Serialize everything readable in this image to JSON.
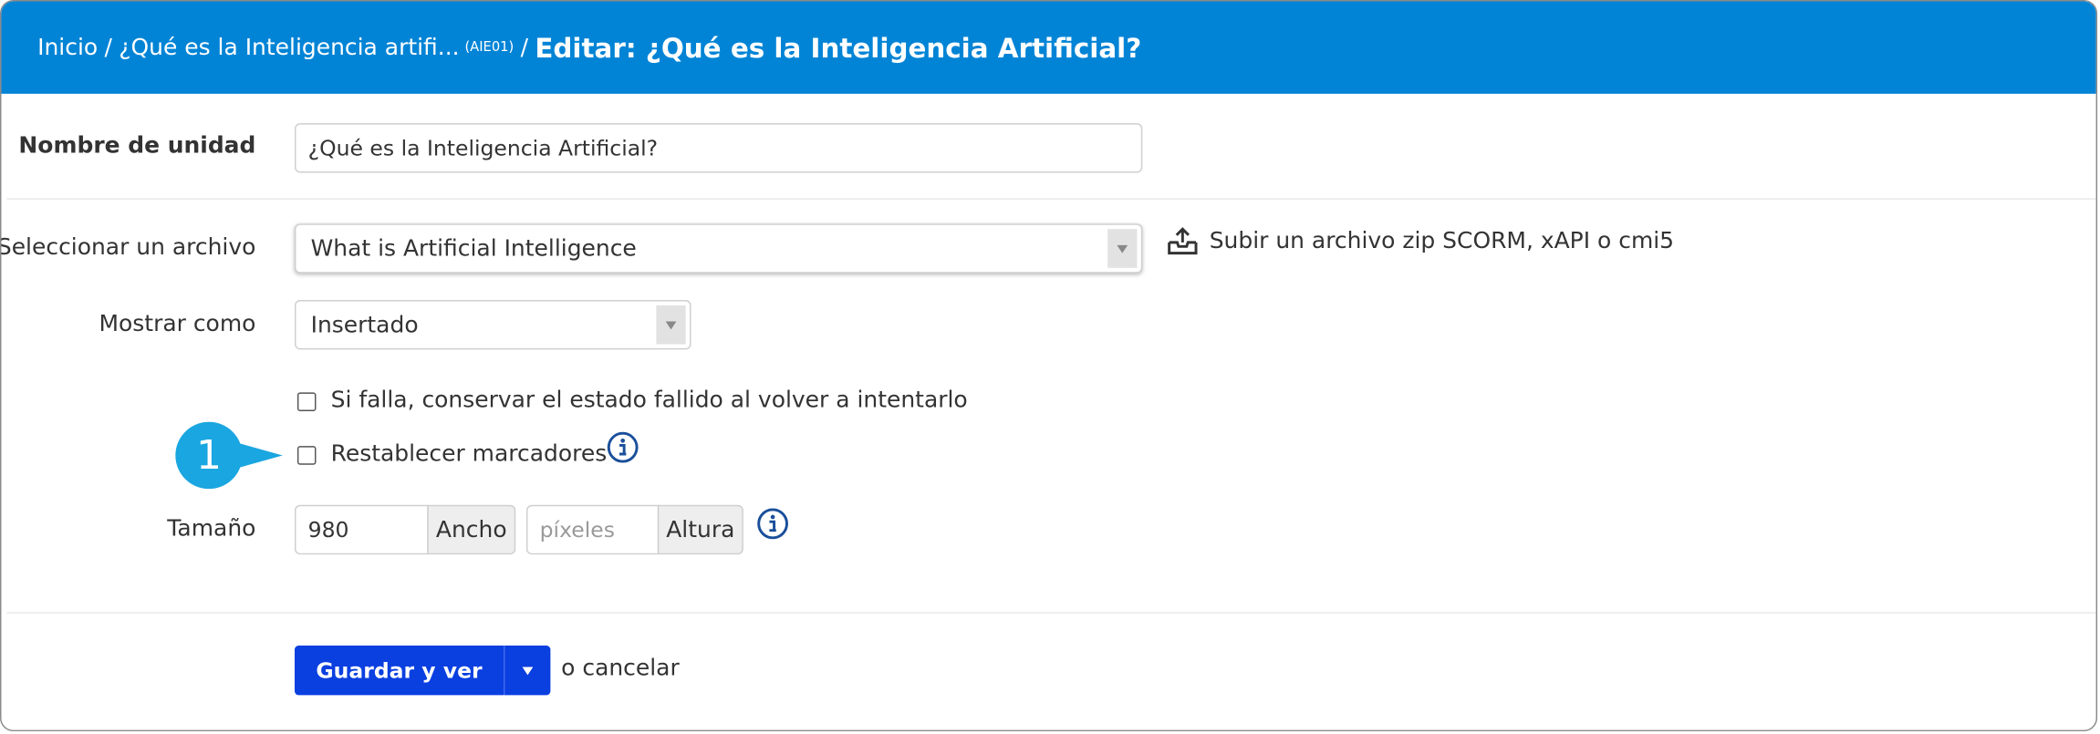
{
  "breadcrumb": {
    "home": "Inicio",
    "separator": "/",
    "course": "¿Qué es la Inteligencia artifi...",
    "course_code": "(AIE01)",
    "current": "Editar: ¿Qué es la Inteligencia Artificial?"
  },
  "unit_name": {
    "label": "Nombre de unidad",
    "value": "¿Qué es la Inteligencia Artificial?"
  },
  "file": {
    "label": "Seleccionar un archivo",
    "selected": "What is Artificial Intelligence",
    "upload_label": "Subir un archivo zip SCORM, xAPI o cmi5"
  },
  "display": {
    "label": "Mostrar como",
    "selected": "Insertado"
  },
  "options": {
    "keep_failed": "Si falla, conservar el estado fallido al volver a intentarlo",
    "reset_bookmarks": "Restablecer marcadores"
  },
  "size": {
    "label": "Tamaño",
    "width_value": "980",
    "width_addon": "Ancho",
    "height_placeholder": "píxeles",
    "height_addon": "Altura"
  },
  "callout": {
    "number": "1"
  },
  "actions": {
    "save_label": "Guardar y ver",
    "cancel_label": "o cancelar"
  },
  "colors": {
    "header_bg": "#0284d6",
    "primary_button": "#0a3fe0",
    "callout": "#1aa6e0",
    "info_icon": "#1a4f9a"
  }
}
